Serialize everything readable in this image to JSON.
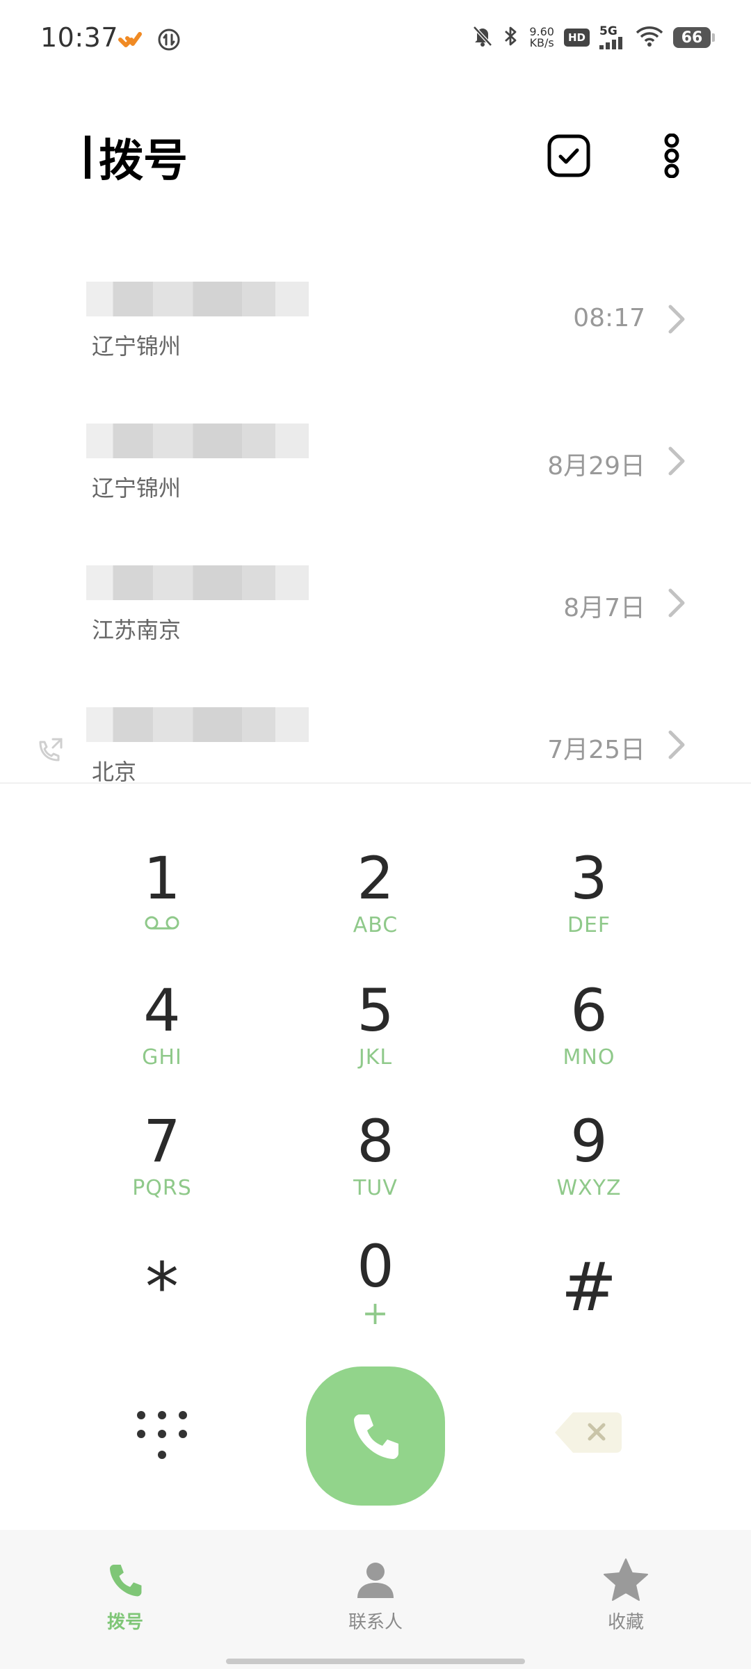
{
  "status_bar": {
    "time": "10:37",
    "speed_value": "9.60",
    "speed_unit": "KB/s",
    "hd_label": "HD",
    "network_label": "5G",
    "battery_level": "66",
    "icons": [
      "orange-app-icon",
      "sync-icon",
      "mute-icon",
      "bluetooth-icon",
      "signal-icon",
      "wifi-icon",
      "battery-icon"
    ]
  },
  "header": {
    "title": "拨号",
    "icons": [
      "select-checkbox-icon",
      "more-vertical-icon"
    ]
  },
  "call_log": [
    {
      "location": "辽宁锦州",
      "time": "08:17"
    },
    {
      "location": "辽宁锦州",
      "time": "8月29日"
    },
    {
      "location": "江苏南京",
      "time": "8月7日"
    },
    {
      "location": "北京",
      "time": "7月25日",
      "type_icon": "outgoing-call-icon"
    }
  ],
  "dialpad": {
    "keys": [
      {
        "digit": "1",
        "letters": ""
      },
      {
        "digit": "2",
        "letters": "ABC"
      },
      {
        "digit": "3",
        "letters": "DEF"
      },
      {
        "digit": "4",
        "letters": "GHI"
      },
      {
        "digit": "5",
        "letters": "JKL"
      },
      {
        "digit": "6",
        "letters": "MNO"
      },
      {
        "digit": "7",
        "letters": "PQRS"
      },
      {
        "digit": "8",
        "letters": "TUV"
      },
      {
        "digit": "9",
        "letters": "WXYZ"
      },
      {
        "digit": "*",
        "letters": ""
      },
      {
        "digit": "0",
        "letters": "+"
      },
      {
        "digit": "#",
        "letters": ""
      }
    ],
    "key1_icon": "voicemail-icon"
  },
  "colors": {
    "accent": "#92d48b",
    "letters": "#8fc98a",
    "nav_active": "#7fc677",
    "nav_inactive": "#8a8a8a"
  },
  "bottom_nav": {
    "items": [
      {
        "label": "拨号",
        "icon": "phone-icon",
        "active": true
      },
      {
        "label": "联系人",
        "icon": "person-icon",
        "active": false
      },
      {
        "label": "收藏",
        "icon": "star-icon",
        "active": false
      }
    ]
  }
}
